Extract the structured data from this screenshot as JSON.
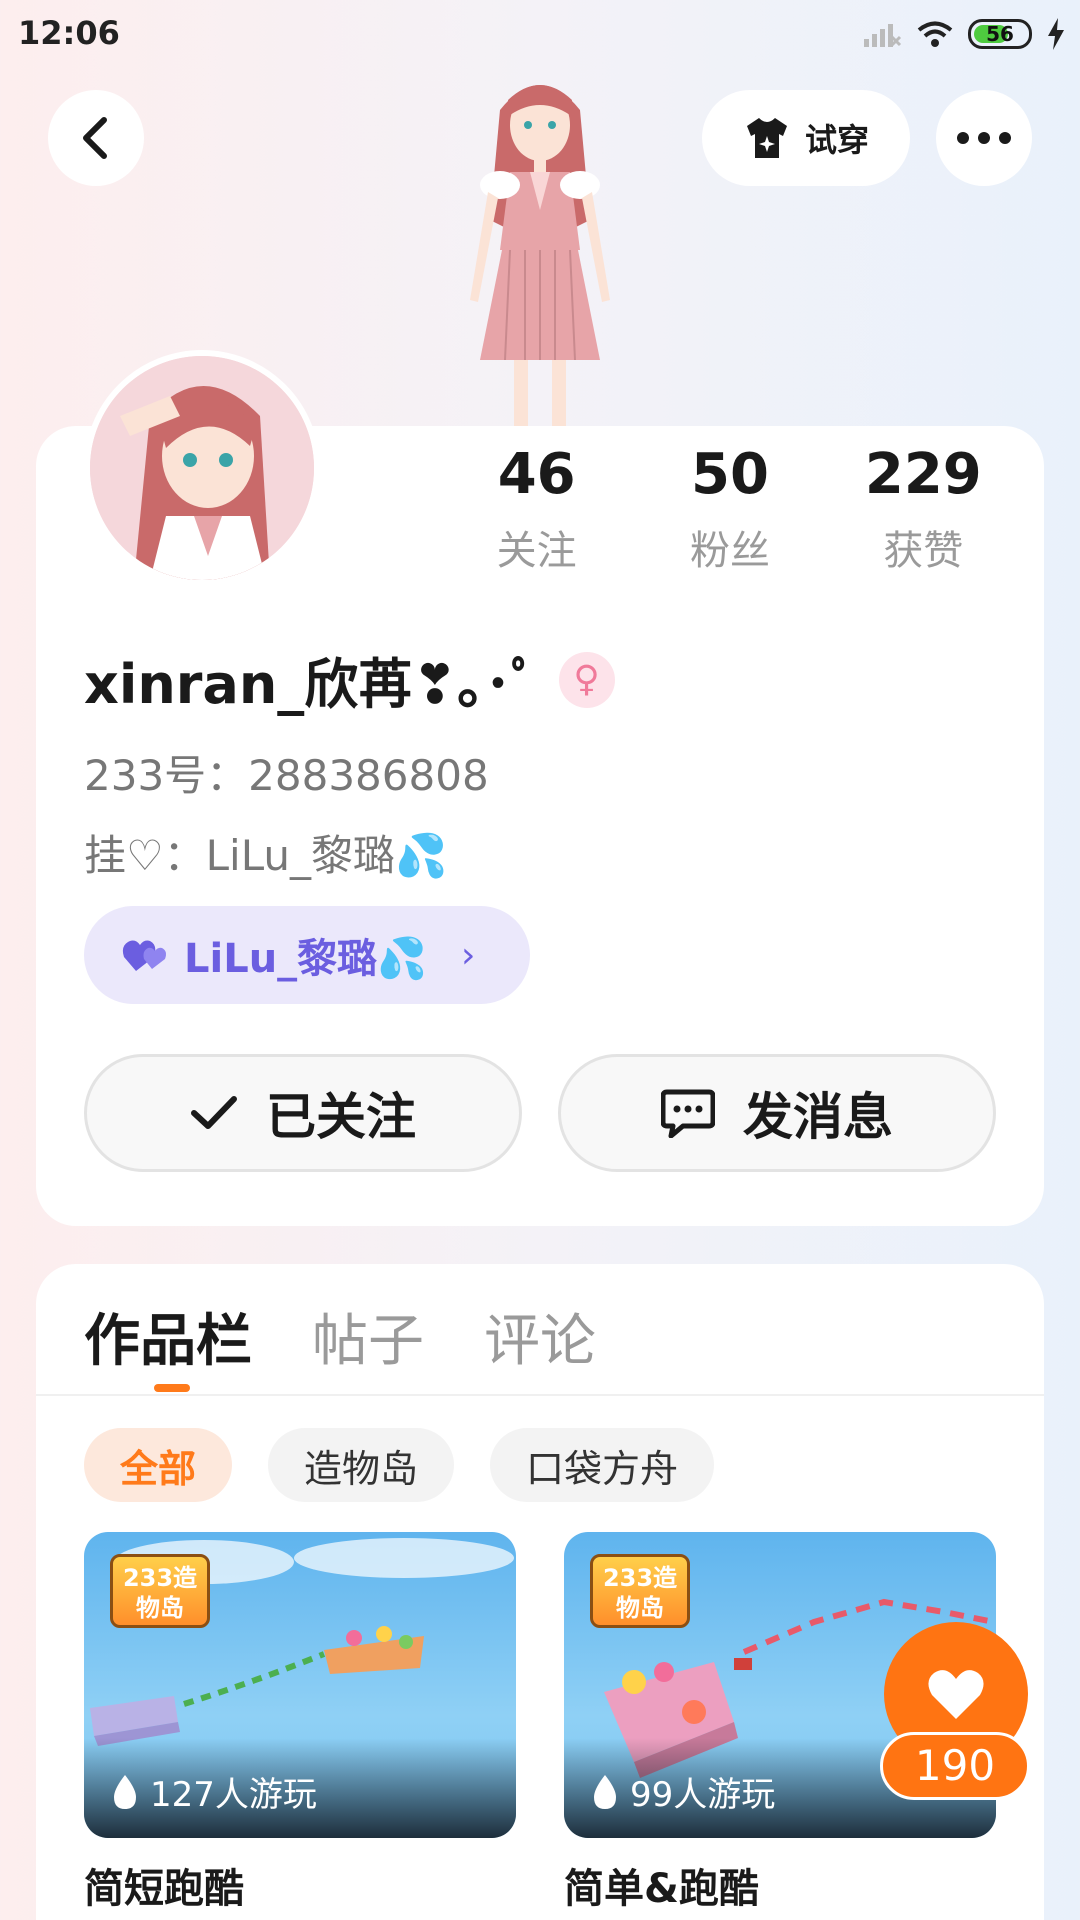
{
  "status_bar": {
    "time": "12:06",
    "battery": "56"
  },
  "header": {
    "tryon_label": "试穿"
  },
  "stats": [
    {
      "value": "46",
      "label": "关注"
    },
    {
      "value": "50",
      "label": "粉丝"
    },
    {
      "value": "229",
      "label": "获赞"
    }
  ],
  "profile": {
    "username": "xinran_欣苒❣｡･ﾟ",
    "uid": "233号：288386808",
    "partner_line": "挂♡：LiLu_黎璐💦",
    "partner_chip": "LiLu_黎璐💦"
  },
  "actions": {
    "follow_label": "已关注",
    "message_label": "发消息"
  },
  "tabs": [
    {
      "label": "作品栏",
      "active": true
    },
    {
      "label": "帖子",
      "active": false
    },
    {
      "label": "评论",
      "active": false
    }
  ],
  "filters": [
    {
      "label": "全部",
      "active": true
    },
    {
      "label": "造物岛",
      "active": false
    },
    {
      "label": "口袋方舟",
      "active": false
    }
  ],
  "games": [
    {
      "title": "简短跑酷",
      "plays": "127人游玩",
      "logo": "233造物岛"
    },
    {
      "title": "简单&跑酷",
      "plays": "99人游玩",
      "logo": "233造物岛"
    }
  ],
  "like": {
    "count": "190"
  },
  "colors": {
    "accent": "#ff7412",
    "partner": "#6b5ee0"
  }
}
